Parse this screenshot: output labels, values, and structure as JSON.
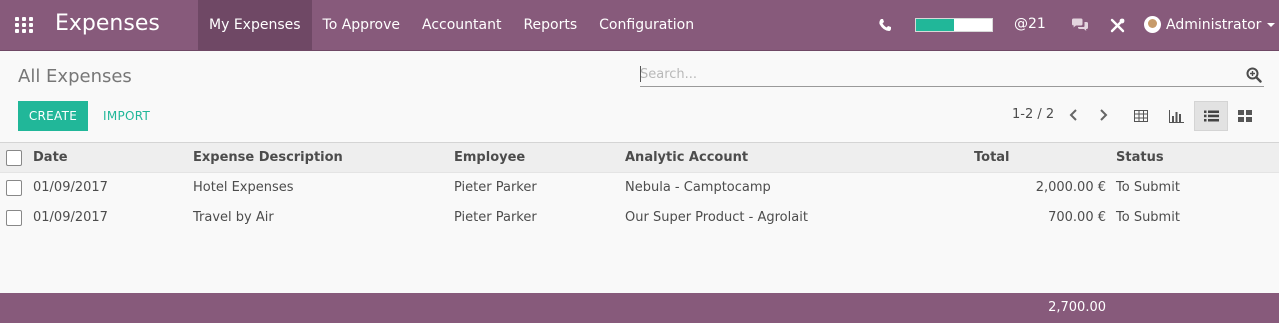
{
  "navbar": {
    "app_title": "Expenses",
    "menu": [
      {
        "label": "My Expenses",
        "active": true
      },
      {
        "label": "To Approve",
        "active": false
      },
      {
        "label": "Accountant",
        "active": false
      },
      {
        "label": "Reports",
        "active": false
      },
      {
        "label": "Configuration",
        "active": false
      }
    ],
    "systray": {
      "phone_icon": "phone-icon",
      "progress_fraction": 0.5,
      "mention": "@21",
      "chat_icon": "chat-icon",
      "tools_icon": "tools-icon",
      "user_name": "Administrator"
    },
    "color": "#875a7b"
  },
  "control_panel": {
    "title": "All Expenses",
    "search": {
      "placeholder": "Search...",
      "value": ""
    },
    "create_label": "CREATE",
    "import_label": "IMPORT",
    "pager": "1-2 / 2",
    "views": [
      "table-view-icon",
      "graph-view-icon",
      "list-view-icon",
      "kanban-view-icon"
    ],
    "active_view": "list-view-icon"
  },
  "table": {
    "headers": [
      "Date",
      "Expense Description",
      "Employee",
      "Analytic Account",
      "Total",
      "Status"
    ],
    "rows": [
      {
        "date": "01/09/2017",
        "description": "Hotel Expenses",
        "employee": "Pieter Parker",
        "account": "Nebula - Camptocamp",
        "total": "2,000.00 €",
        "status": "To Submit"
      },
      {
        "date": "01/09/2017",
        "description": "Travel by Air",
        "employee": "Pieter Parker",
        "account": "Our Super Product - Agrolait",
        "total": "700.00 €",
        "status": "To Submit"
      }
    ],
    "footer_total": "2,700.00"
  },
  "colors": {
    "accent": "#21b799",
    "brand": "#875a7b"
  }
}
